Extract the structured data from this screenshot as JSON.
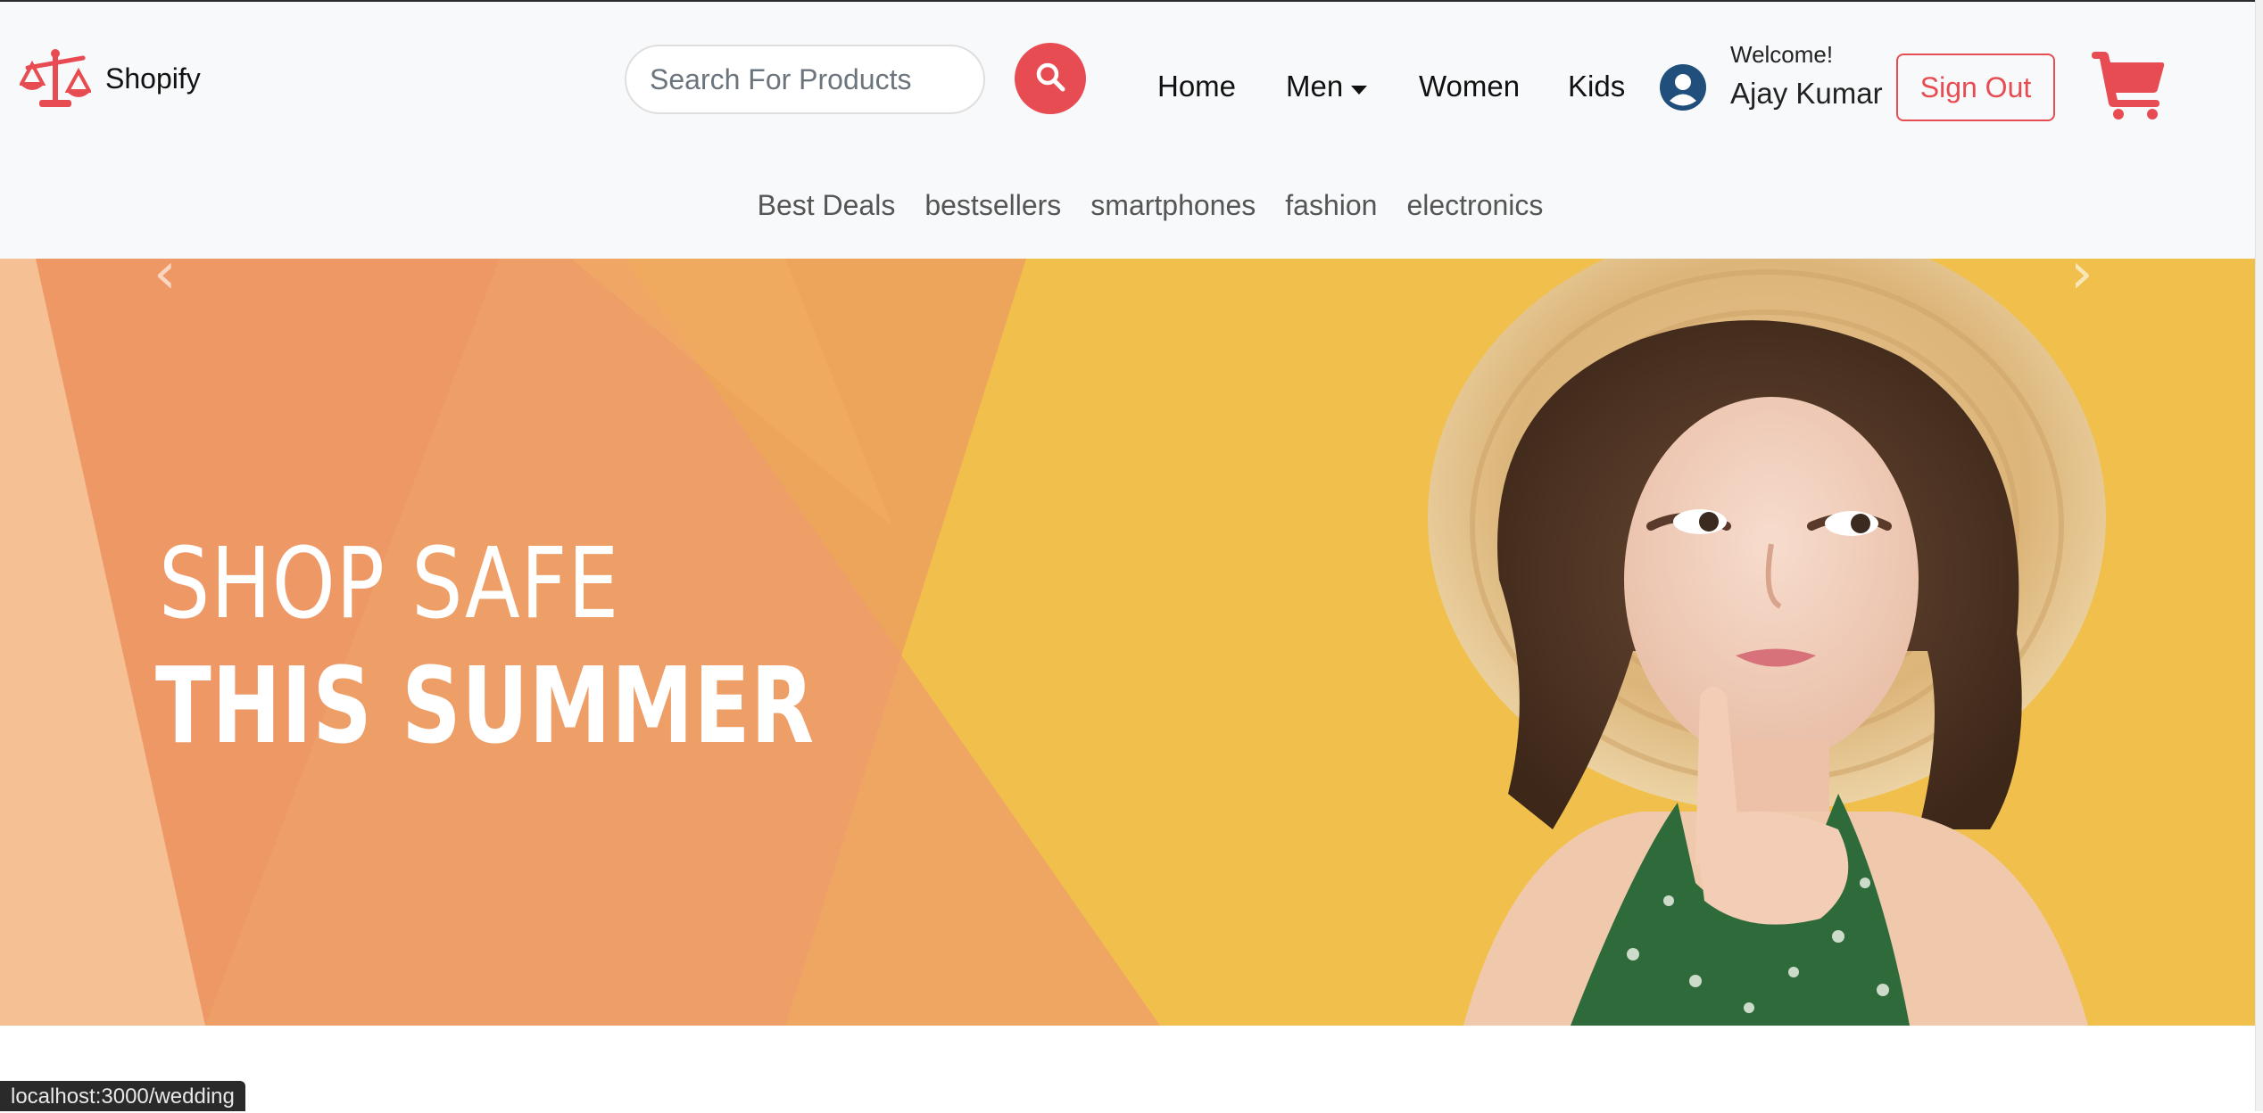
{
  "brand": {
    "name": "Shopify",
    "logo_icon": "balance-scale-icon",
    "accent": "#e84c53"
  },
  "search": {
    "placeholder": "Search For Products",
    "value": "",
    "button_icon": "search-icon"
  },
  "nav": {
    "home": "Home",
    "men": "Men",
    "women": "Women",
    "kids": "Kids"
  },
  "user": {
    "welcome": "Welcome!",
    "name": "Ajay Kumar",
    "avatar_icon": "user-circle-icon",
    "sign_out": "Sign Out"
  },
  "cart": {
    "icon": "shopping-cart-icon"
  },
  "categories": [
    "Best Deals",
    "bestsellers",
    "smartphones",
    "fashion",
    "electronics"
  ],
  "banner": {
    "line1": "SHOP SAFE",
    "line2": "THIS SUMMER",
    "prev_arrow": "‹",
    "next_arrow": "›",
    "background": "#f1c04c"
  },
  "status_bar": {
    "url": "localhost:3000/wedding"
  }
}
